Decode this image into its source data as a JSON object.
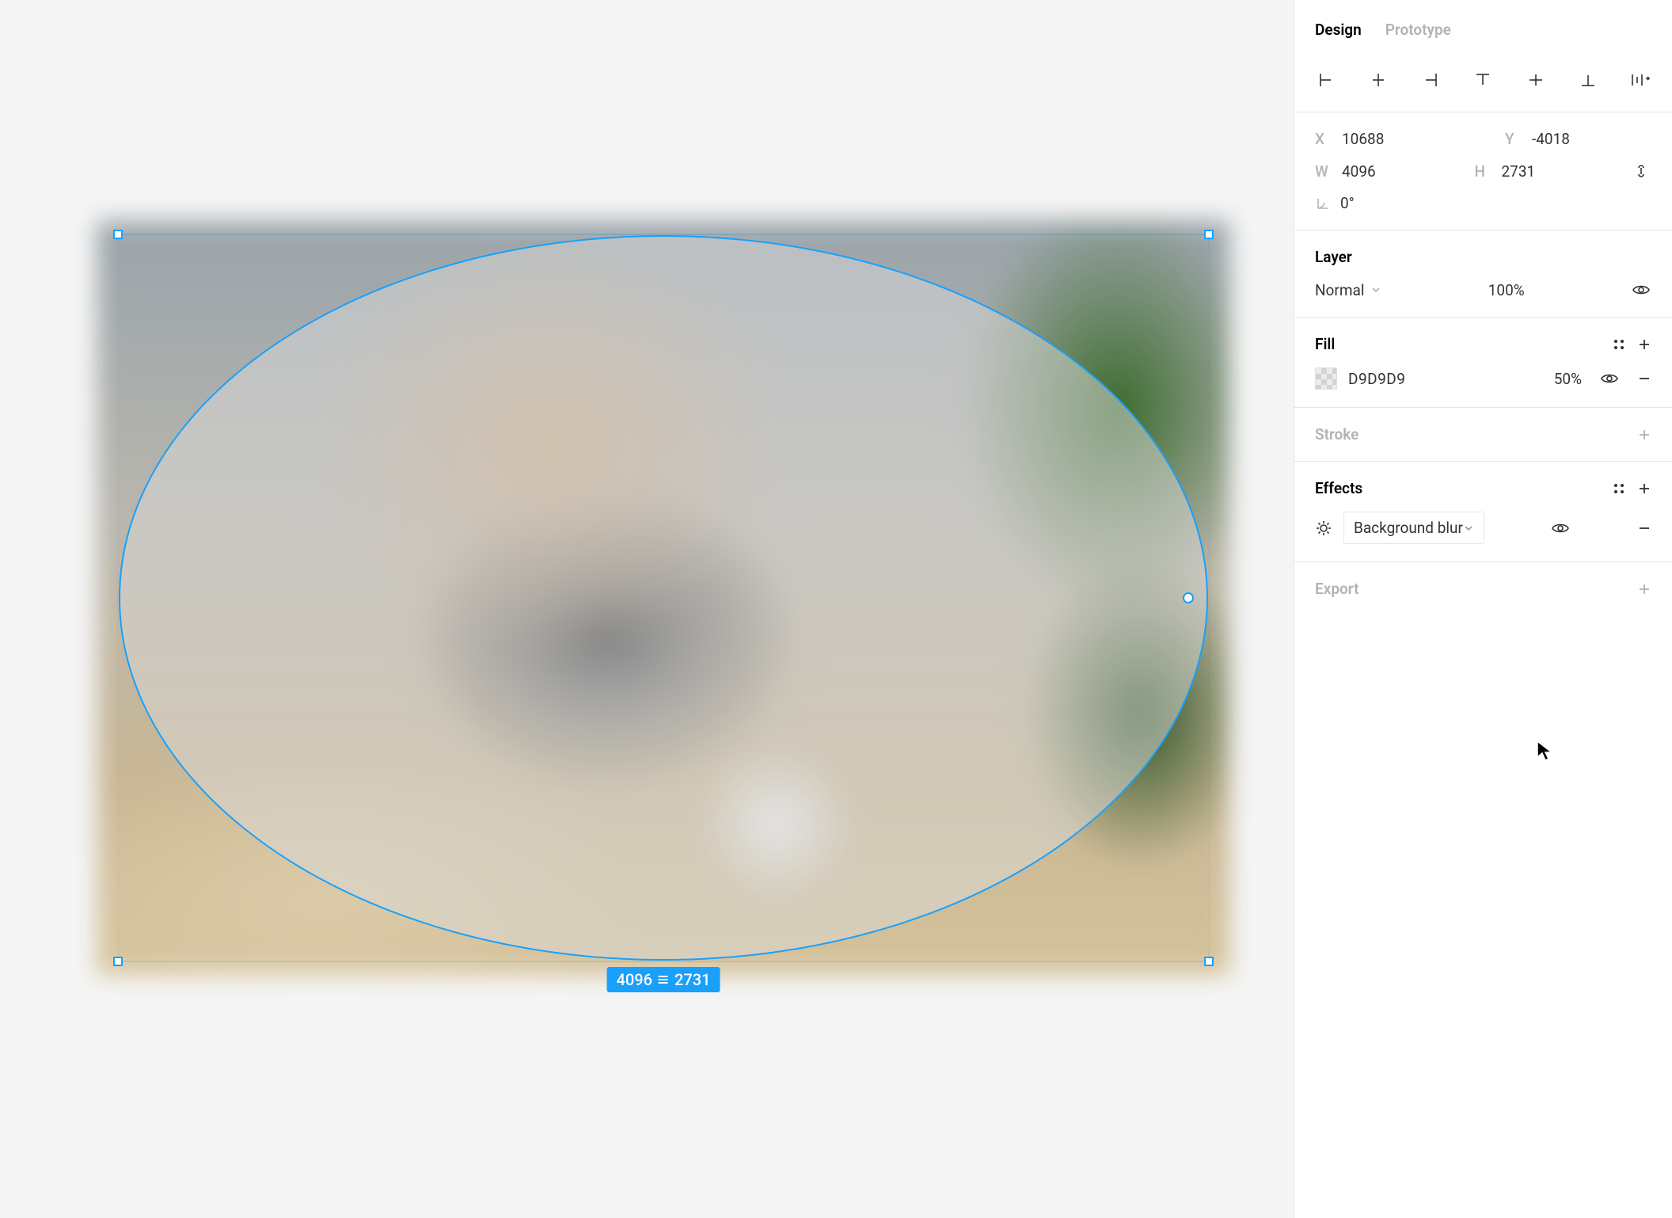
{
  "tabs": {
    "design": "Design",
    "prototype": "Prototype"
  },
  "transform": {
    "x_label": "X",
    "x": "10688",
    "y_label": "Y",
    "y": "-4018",
    "w_label": "W",
    "w": "4096",
    "h_label": "H",
    "h": "2731",
    "rotation": "0°"
  },
  "selection_badge": {
    "w": "4096",
    "h": "2731"
  },
  "layer": {
    "title": "Layer",
    "blend_mode": "Normal",
    "opacity": "100%"
  },
  "fill": {
    "title": "Fill",
    "hex": "D9D9D9",
    "opacity": "50%"
  },
  "stroke": {
    "title": "Stroke"
  },
  "effects": {
    "title": "Effects",
    "type": "Background blur"
  },
  "export": {
    "title": "Export"
  }
}
